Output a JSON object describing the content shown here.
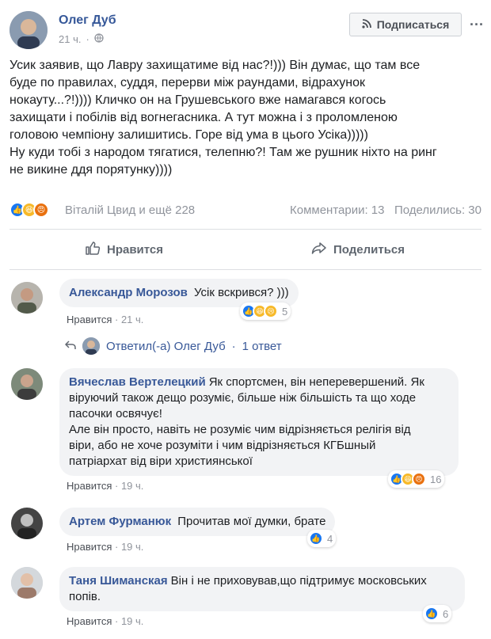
{
  "post": {
    "author": "Олег Дуб",
    "time": "21 ч.",
    "subscribe_label": "Подписаться",
    "more": "···",
    "text_lines": [
      "Усик заявив, що Лавру захищатиме від нас?!))) Він думає, що там все",
      "буде по правилах, суддя, перерви між раундами, відрахунок",
      "нокауту...?!)))) Кличко он на Грушевського вже намагався когось",
      "захищати і побілів від вогнегасника. А тут можна і з проломленою",
      "головою чемпіону залишитись. Горе від ума в цього Усіка)))))",
      "Ну куди тобі з народом тягатися, телепню?! Там же рушник ніхто на ринг",
      "не викине ддя порятунку))))"
    ],
    "reactions_names": "Віталій Цвид и ещё 228",
    "comments_count": "Комментарии: 13",
    "shares_count": "Поделились: 30",
    "like_label": "Нравится",
    "share_label": "Поделиться"
  },
  "comments": [
    {
      "name": "Александр Морозов",
      "text": "Усік вскрився? )))",
      "like": "Нравится",
      "time": "21 ч.",
      "reactions_count": "5"
    },
    {
      "name": "Вячеслав Вертелецкий",
      "text_lines": [
        "Як спортсмен, він неперевершений. Як",
        "віруючий також дещо розуміє, більше ніж більшість та що ходе",
        "пасочки освячує!",
        "Але він просто, навіть не розуміє чим відрізняється релігія від",
        "віри, або не хоче розуміти і чим відрізняється КГБшный",
        "патріархат від віри християнської"
      ],
      "like": "Нравится",
      "time": "19 ч.",
      "reactions_count": "16"
    },
    {
      "name": "Артем Фурманюк",
      "text": "Прочитав мої думки, брате",
      "like": "Нравится",
      "time": "19 ч.",
      "reactions_count": "4"
    },
    {
      "name": "Таня Шиманская",
      "text_lines": [
        "Він і не приховував,що підтримує московських",
        "попів."
      ],
      "like": "Нравится",
      "time": "19 ч.",
      "reactions_count": "6"
    }
  ],
  "reply": {
    "text": "Ответил(-а) Олег Дуб",
    "sep": "·",
    "count": "1 ответ"
  },
  "colors": {
    "link": "#385898",
    "like_blue": "#1877f2",
    "haha_yellow": "#f7b928",
    "angry_orange": "#e9710f",
    "meta_gray": "#90949c"
  }
}
